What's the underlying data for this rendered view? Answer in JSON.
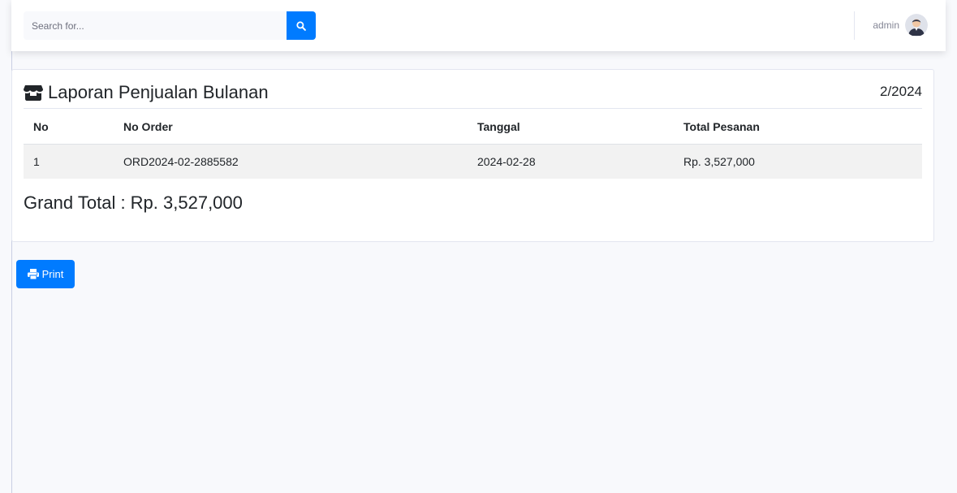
{
  "topbar": {
    "search_placeholder": "Search for...",
    "search_icon": "search-icon",
    "user_name": "admin",
    "avatar_icon": "user-avatar"
  },
  "report": {
    "icon": "store-icon",
    "title": "Laporan Penjualan Bulanan",
    "period": "2/2024",
    "columns": [
      "No",
      "No Order",
      "Tanggal",
      "Total Pesanan"
    ],
    "rows": [
      {
        "no": "1",
        "order": "ORD2024-02-2885582",
        "date": "2024-02-28",
        "total": "Rp. 3,527,000"
      }
    ],
    "grand_total": "Grand Total : Rp. 3,527,000"
  },
  "actions": {
    "print_label": "Print",
    "print_icon": "printer-icon"
  },
  "colors": {
    "primary": "#007bff",
    "background": "#f8f9fc",
    "row_striped": "#f2f2f2"
  }
}
